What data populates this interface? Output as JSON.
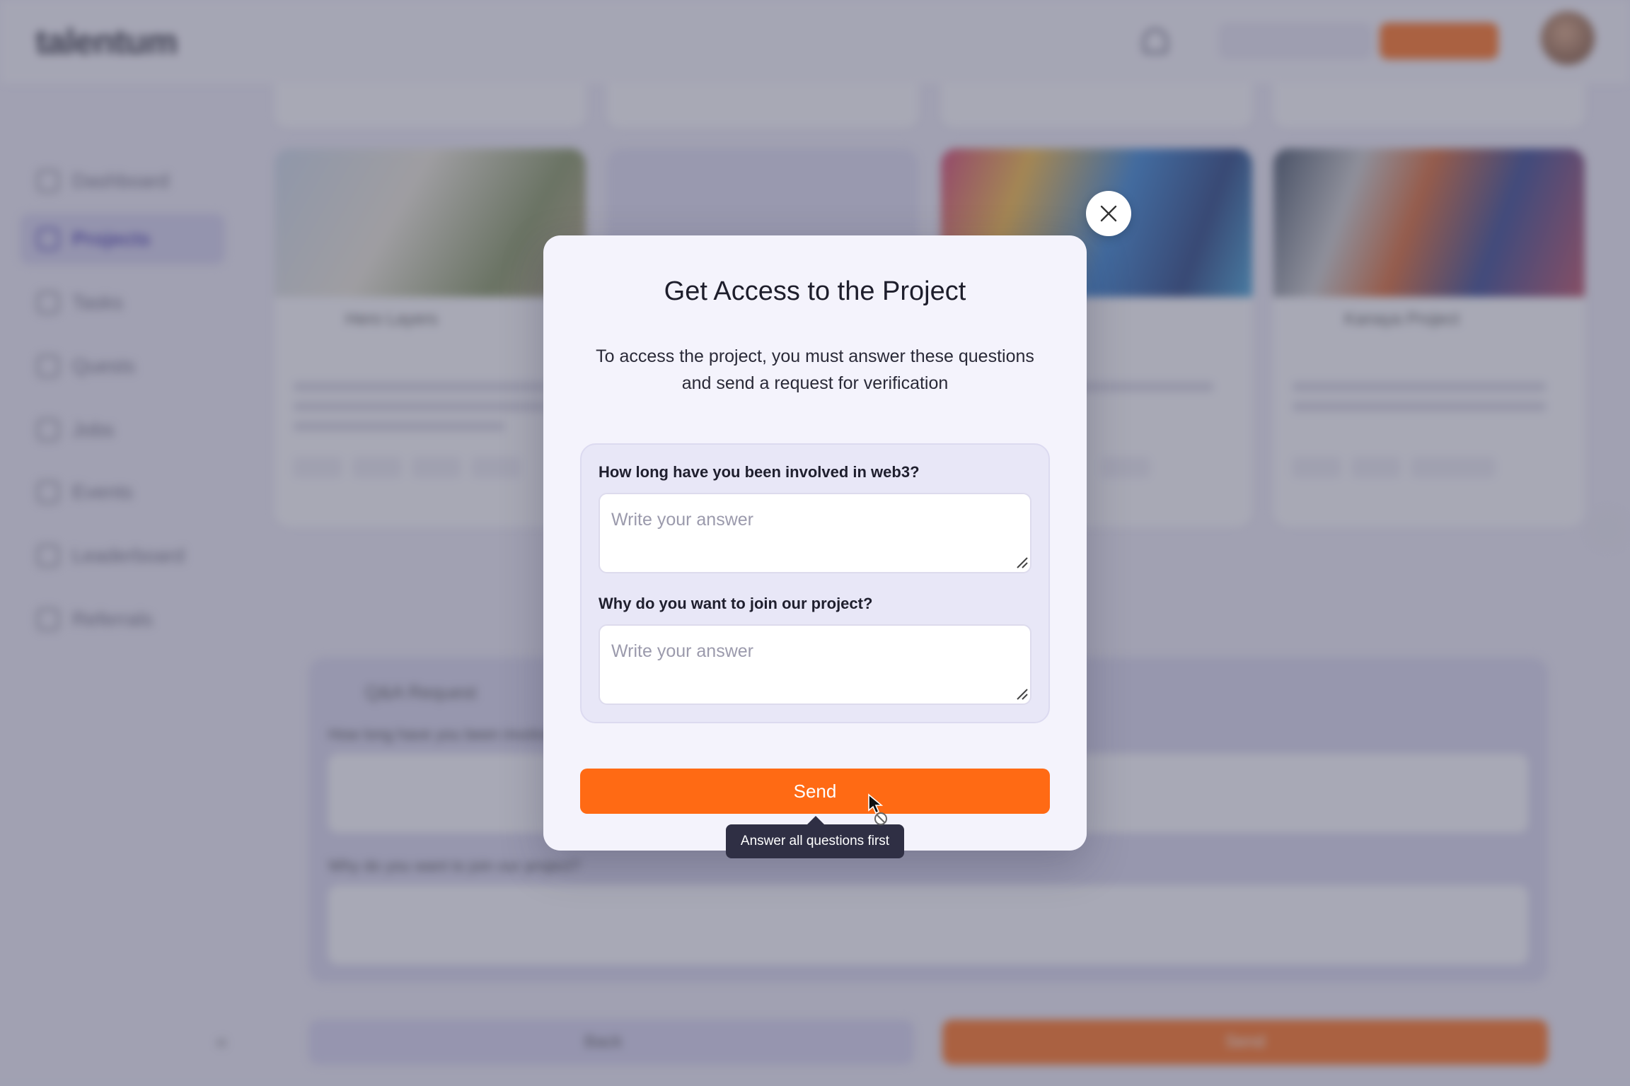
{
  "background": {
    "logo": "talentum",
    "points_label": "",
    "cta_label": "",
    "sidebar_items": [
      {
        "label": "Dashboard",
        "active": false
      },
      {
        "label": "Projects",
        "active": true
      },
      {
        "label": "Tasks",
        "active": false
      },
      {
        "label": "Quests",
        "active": false
      },
      {
        "label": "Jobs",
        "active": false
      },
      {
        "label": "Events",
        "active": false
      },
      {
        "label": "Leaderboard",
        "active": false
      },
      {
        "label": "Referrals",
        "active": false
      }
    ],
    "cards": [
      {
        "name": "Hero Layers"
      },
      {
        "name": ""
      },
      {
        "name": ""
      },
      {
        "name": "Kanaya Project"
      }
    ],
    "qa_title": "Q&A Request",
    "qa_q1": "How long have you been involved in web3?",
    "qa_q2": "Why do you want to join our project?",
    "back_label": "Back",
    "send_label": "Send"
  },
  "modal": {
    "title": "Get Access to the Project",
    "description": "To access the project, you must answer these questions and send a request for verification",
    "questions": [
      {
        "label": "How long have you been involved in web3?",
        "placeholder": "Write your answer",
        "value": ""
      },
      {
        "label": "Why do you want to join our project?",
        "placeholder": "Write your answer",
        "value": ""
      }
    ],
    "send_label": "Send",
    "tooltip": "Answer all questions first",
    "close_icon": "close-icon",
    "accent_color": "#ff6a14"
  }
}
